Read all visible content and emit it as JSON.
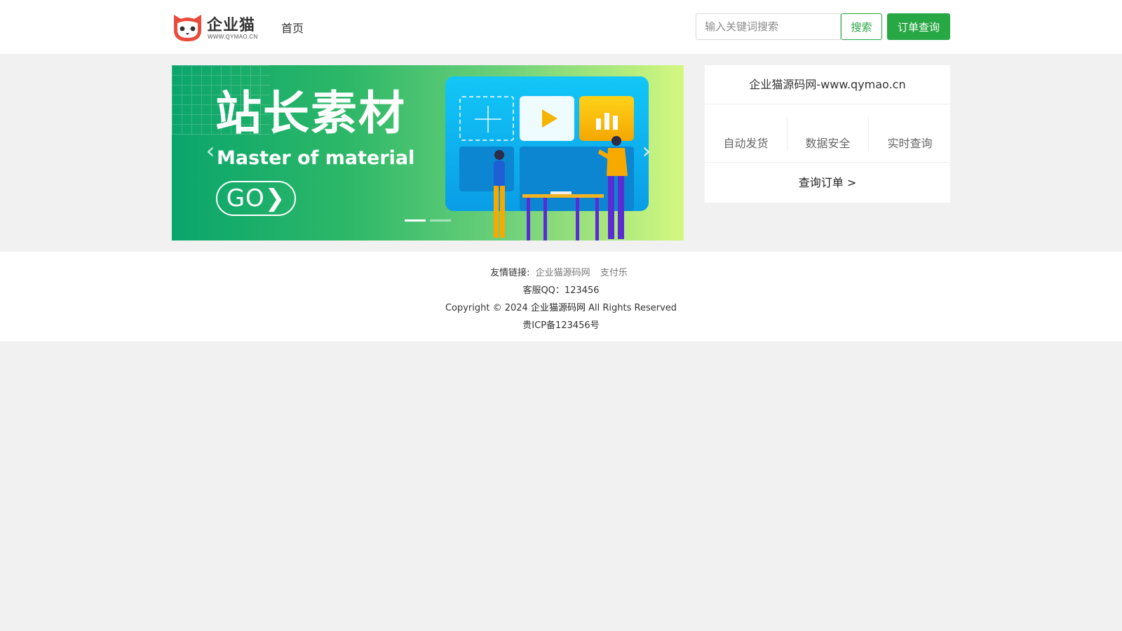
{
  "header": {
    "logo_text": "企业猫",
    "logo_sub": "WWW.QYMAO.CN",
    "nav_home": "首页",
    "search_placeholder": "输入关键词搜索",
    "search_label": "搜索",
    "order_label": "订单查询",
    "accent_color": "#28a745"
  },
  "banner": {
    "title": "站长素材",
    "subtitle": "Master of material",
    "go_label": "GO",
    "prev_arrow": "‹",
    "next_arrow": "›",
    "slide_count": 2,
    "active_slide": 1
  },
  "panel": {
    "title": "企业猫源码网-www.qymao.cn",
    "features": [
      "自动发货",
      "数据安全",
      "实时查询"
    ],
    "query_link": "查询订单 >"
  },
  "footer": {
    "links_label": "友情链接:",
    "links": [
      "企业猫源码网",
      "支付乐"
    ],
    "qq_line": "客服QQ：123456",
    "copyright_prefix": "Copyright © 2024",
    "copyright_brand": "企业猫源码网",
    "copyright_suffix": "All Rights Reserved",
    "icp": "贵ICP备123456号"
  }
}
